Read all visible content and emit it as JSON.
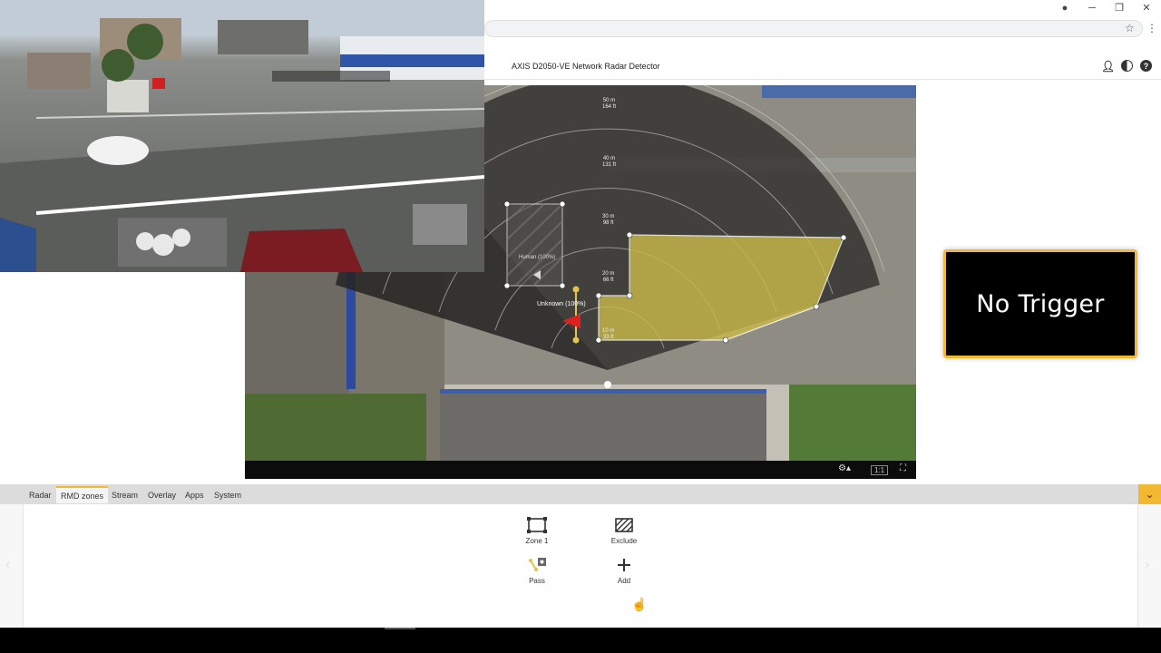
{
  "device_title": "AXIS D2050-VE Network Radar Detector",
  "trigger_status": "No Trigger",
  "radar": {
    "range_rings": [
      {
        "m": "50 m",
        "ft": "164 ft"
      },
      {
        "m": "40 m",
        "ft": "131 ft"
      },
      {
        "m": "30 m",
        "ft": "98 ft"
      },
      {
        "m": "20 m",
        "ft": "66 ft"
      },
      {
        "m": "10 m",
        "ft": "33 ft"
      }
    ],
    "objects": [
      {
        "label": "Unknown (100%)"
      },
      {
        "label": "Human (100%)"
      }
    ],
    "toolbar": {
      "ratio": "1:1"
    }
  },
  "tabs": [
    {
      "label": "Radar",
      "active": false
    },
    {
      "label": "RMD zones",
      "active": true
    },
    {
      "label": "Stream",
      "active": false
    },
    {
      "label": "Overlay",
      "active": false
    },
    {
      "label": "Apps",
      "active": false
    },
    {
      "label": "System",
      "active": false
    }
  ],
  "zones": [
    {
      "label": "Zone 1",
      "icon": "zone-rectangle-icon"
    },
    {
      "label": "Exclude",
      "icon": "exclude-hatched-icon"
    },
    {
      "label": "Pass",
      "icon": "pass-icon"
    },
    {
      "label": "Add",
      "icon": "plus-icon"
    }
  ],
  "colors": {
    "accent": "#f2b82f",
    "trigger_bg": "#000000",
    "include_zone": "#c9b84a"
  }
}
